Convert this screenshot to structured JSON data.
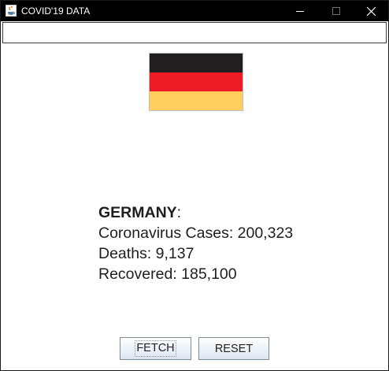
{
  "window": {
    "title": "COVID'19 DATA",
    "icon": "java-cup-icon",
    "controls": [
      "minimize-icon",
      "maximize-icon",
      "close-icon"
    ]
  },
  "search": {
    "value": "",
    "placeholder": ""
  },
  "flag": {
    "country": "Germany",
    "colors": [
      "#231f20",
      "#ed1c24",
      "#ffce5c"
    ]
  },
  "stats": {
    "country": "GERMANY",
    "country_suffix": ":",
    "cases": "Coronavirus Cases: 200,323",
    "deaths": "Deaths: 9,137",
    "recovered": "Recovered: 185,100"
  },
  "buttons": {
    "fetch_label": "FETCH",
    "reset_label": "RESET"
  }
}
